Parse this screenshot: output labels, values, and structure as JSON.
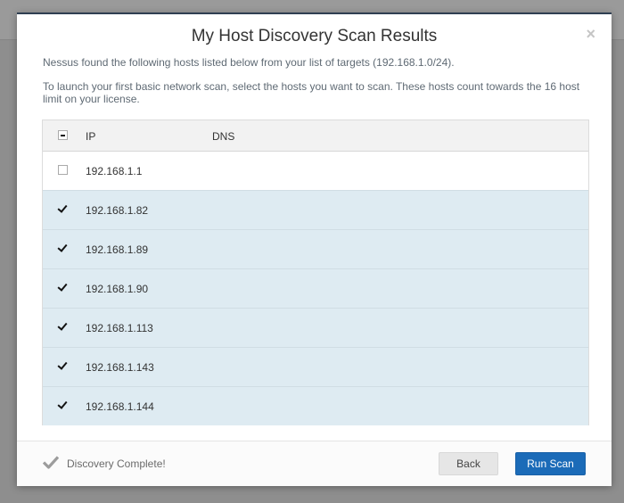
{
  "modal": {
    "title": "My Host Discovery Scan Results",
    "close_glyph": "×",
    "description_line1": "Nessus found the following hosts listed below from your list of targets (192.168.1.0/24).",
    "description_line2": "To launch your first basic network scan, select the hosts you want to scan. These hosts count towards the 16 host limit on your license."
  },
  "table": {
    "columns": {
      "ip": "IP",
      "dns": "DNS"
    },
    "rows": [
      {
        "ip": "192.168.1.1",
        "dns": "",
        "checked": false
      },
      {
        "ip": "192.168.1.82",
        "dns": "",
        "checked": true
      },
      {
        "ip": "192.168.1.89",
        "dns": "",
        "checked": true
      },
      {
        "ip": "192.168.1.90",
        "dns": "",
        "checked": true
      },
      {
        "ip": "192.168.1.113",
        "dns": "",
        "checked": true
      },
      {
        "ip": "192.168.1.143",
        "dns": "",
        "checked": true
      },
      {
        "ip": "192.168.1.144",
        "dns": "",
        "checked": true
      }
    ]
  },
  "footer": {
    "status_icon": "checkmark-icon",
    "status_text": "Discovery Complete!",
    "back_label": "Back",
    "run_label": "Run Scan"
  },
  "colors": {
    "primary_button": "#1b6bb8",
    "selected_row": "#deebf2",
    "modal_border": "#2f3f52"
  }
}
